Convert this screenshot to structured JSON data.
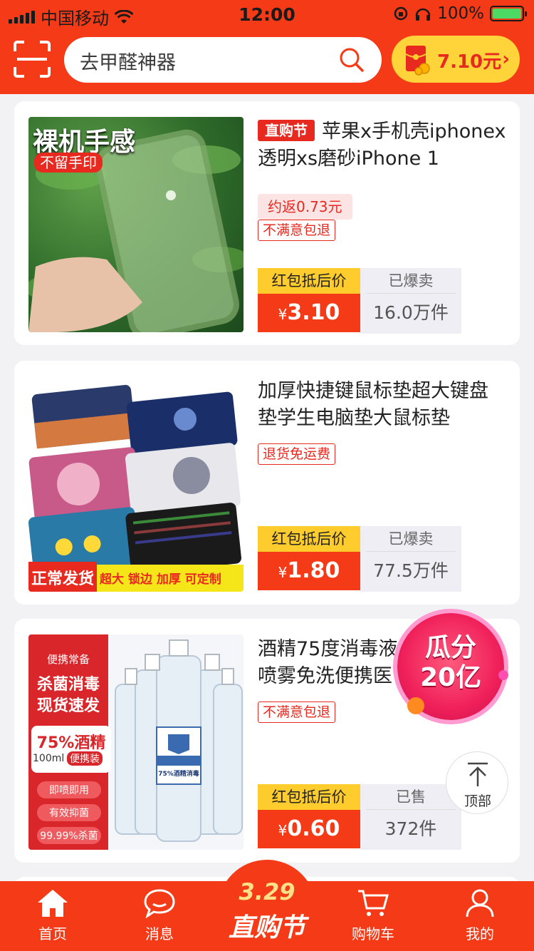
{
  "status_bar": {
    "carrier": "中国移动",
    "time": "12:00",
    "battery": "100%"
  },
  "header": {
    "search_placeholder": "去甲醛神器",
    "redpacket_amount": "7.10元"
  },
  "products": [
    {
      "tag": "直购节",
      "title": "苹果x手机壳iphonex透明xs磨砂iPhone 1",
      "rebate": "约返0.73元",
      "badge": "不满意包退",
      "price_label": "红包抵后价",
      "currency": "¥",
      "price": "3.10",
      "sold_label": "已爆卖",
      "sold": "16.0万件",
      "thumb_caption1": "裸机手感",
      "thumb_caption2": "不留手印"
    },
    {
      "title": "加厚快捷键鼠标垫超大键盘垫学生电脑垫大鼠标垫",
      "badge": "退货免运费",
      "price_label": "红包抵后价",
      "currency": "¥",
      "price": "1.80",
      "sold_label": "已爆卖",
      "sold": "77.5万件",
      "thumb_caption1": "正常发货",
      "thumb_caption2": "超大 锁边 加厚 可定制"
    },
    {
      "title": "酒精75度消毒液喷雾免洗便携医用",
      "badge": "不满意包退",
      "price_label": "红包抵后价",
      "currency": "¥",
      "price": "0.60",
      "sold_label": "已售",
      "sold": "372件",
      "thumb_caption1": "便携常备",
      "thumb_caption2": "杀菌消毒",
      "thumb_caption3": "现货速发",
      "thumb_caption4": "75%酒精",
      "thumb_caption5": "100ml",
      "thumb_caption6": "便携装",
      "thumb_caption7": "即喷即用",
      "thumb_caption8": "有效抑菌",
      "thumb_caption9": "99.99%杀菌",
      "thumb_bottle_label": "75%酒精消毒"
    }
  ],
  "floating": {
    "guafen_line1": "瓜分",
    "guafen_line2": "20亿",
    "totop_label": "顶部"
  },
  "tabbar": {
    "home": "首页",
    "messages": "消息",
    "fest_date": "3.29",
    "fest_name": "直购节",
    "cart": "购物车",
    "mine": "我的"
  },
  "colors": {
    "brand_red": "#f43a16",
    "price_yellow": "#ffcc2e",
    "tag_red": "#e8291f"
  }
}
